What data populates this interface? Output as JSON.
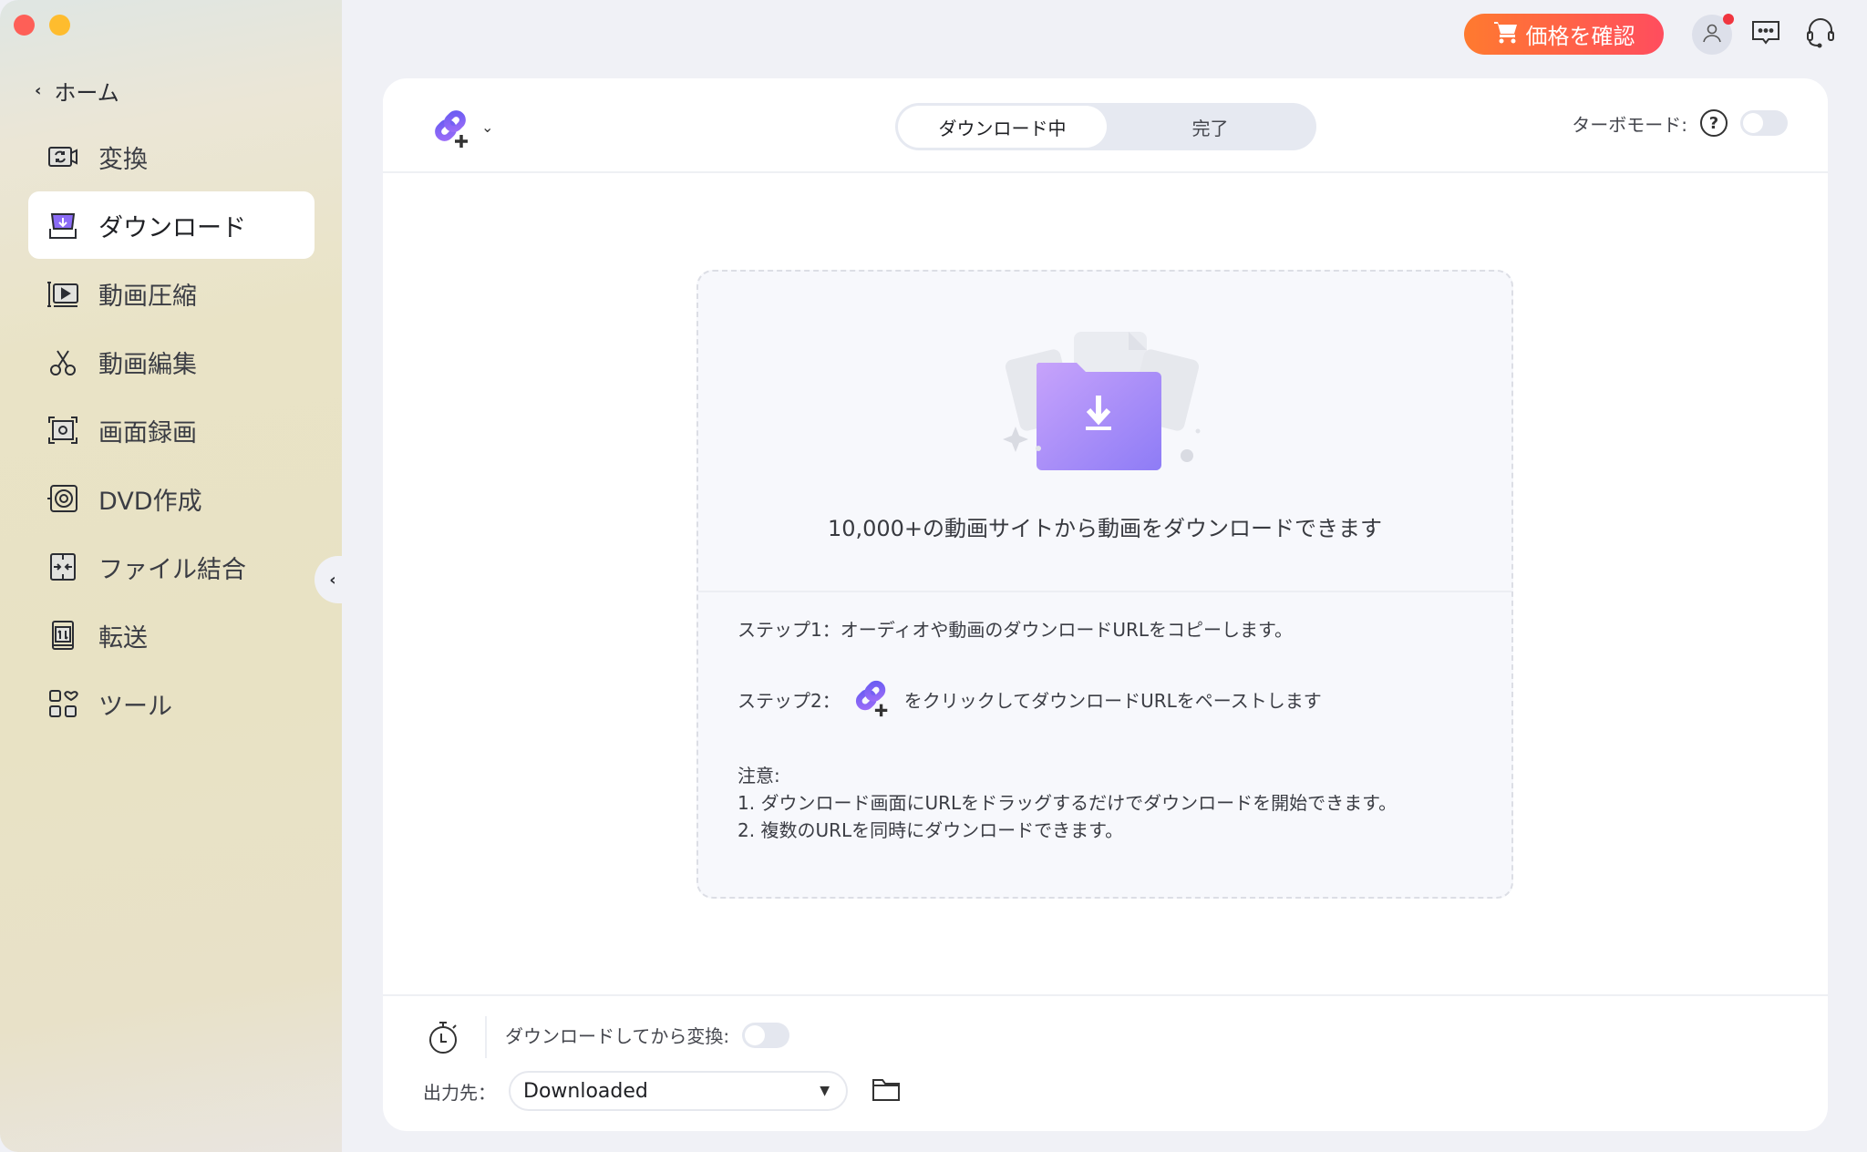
{
  "window": {
    "traffic_lights": [
      "close",
      "minimize"
    ]
  },
  "sidebar": {
    "home_label": "ホーム",
    "items": [
      {
        "label": "変換",
        "icon": "convert-icon",
        "active": false
      },
      {
        "label": "ダウンロード",
        "icon": "download-icon",
        "active": true
      },
      {
        "label": "動画圧縮",
        "icon": "compress-icon",
        "active": false
      },
      {
        "label": "動画編集",
        "icon": "scissors-icon",
        "active": false
      },
      {
        "label": "画面録画",
        "icon": "screen-record-icon",
        "active": false
      },
      {
        "label": "DVD作成",
        "icon": "dvd-icon",
        "active": false
      },
      {
        "label": "ファイル結合",
        "icon": "merge-icon",
        "active": false
      },
      {
        "label": "転送",
        "icon": "transfer-icon",
        "active": false
      },
      {
        "label": "ツール",
        "icon": "tools-icon",
        "active": false
      }
    ]
  },
  "topbar": {
    "price_button": "価格を確認",
    "has_notification": true
  },
  "header": {
    "tabs": [
      {
        "label": "ダウンロード中",
        "active": true
      },
      {
        "label": "完了",
        "active": false
      }
    ],
    "turbo_label": "ターボモード:",
    "turbo_enabled": false
  },
  "drop": {
    "title": "10,000+の動画サイトから動画をダウンロードできます",
    "step1": "ステップ1：オーディオや動画のダウンロードURLをコピーします。",
    "step2_prefix": "ステップ2：",
    "step2_suffix": "をクリックしてダウンロードURLをペーストします",
    "note_title": "注意:",
    "notes": [
      "1. ダウンロード画面にURLをドラッグするだけでダウンロードを開始できます。",
      "2. 複数のURLを同時にダウンロードできます。"
    ]
  },
  "footer": {
    "convert_label": "ダウンロードしてから変換:",
    "convert_enabled": false,
    "output_label": "出力先：",
    "output_value": "Downloaded"
  },
  "colors": {
    "accent": "#8b6cf6",
    "price_gradient_start": "#ff7a2f",
    "price_gradient_end": "#ff4d5e"
  }
}
